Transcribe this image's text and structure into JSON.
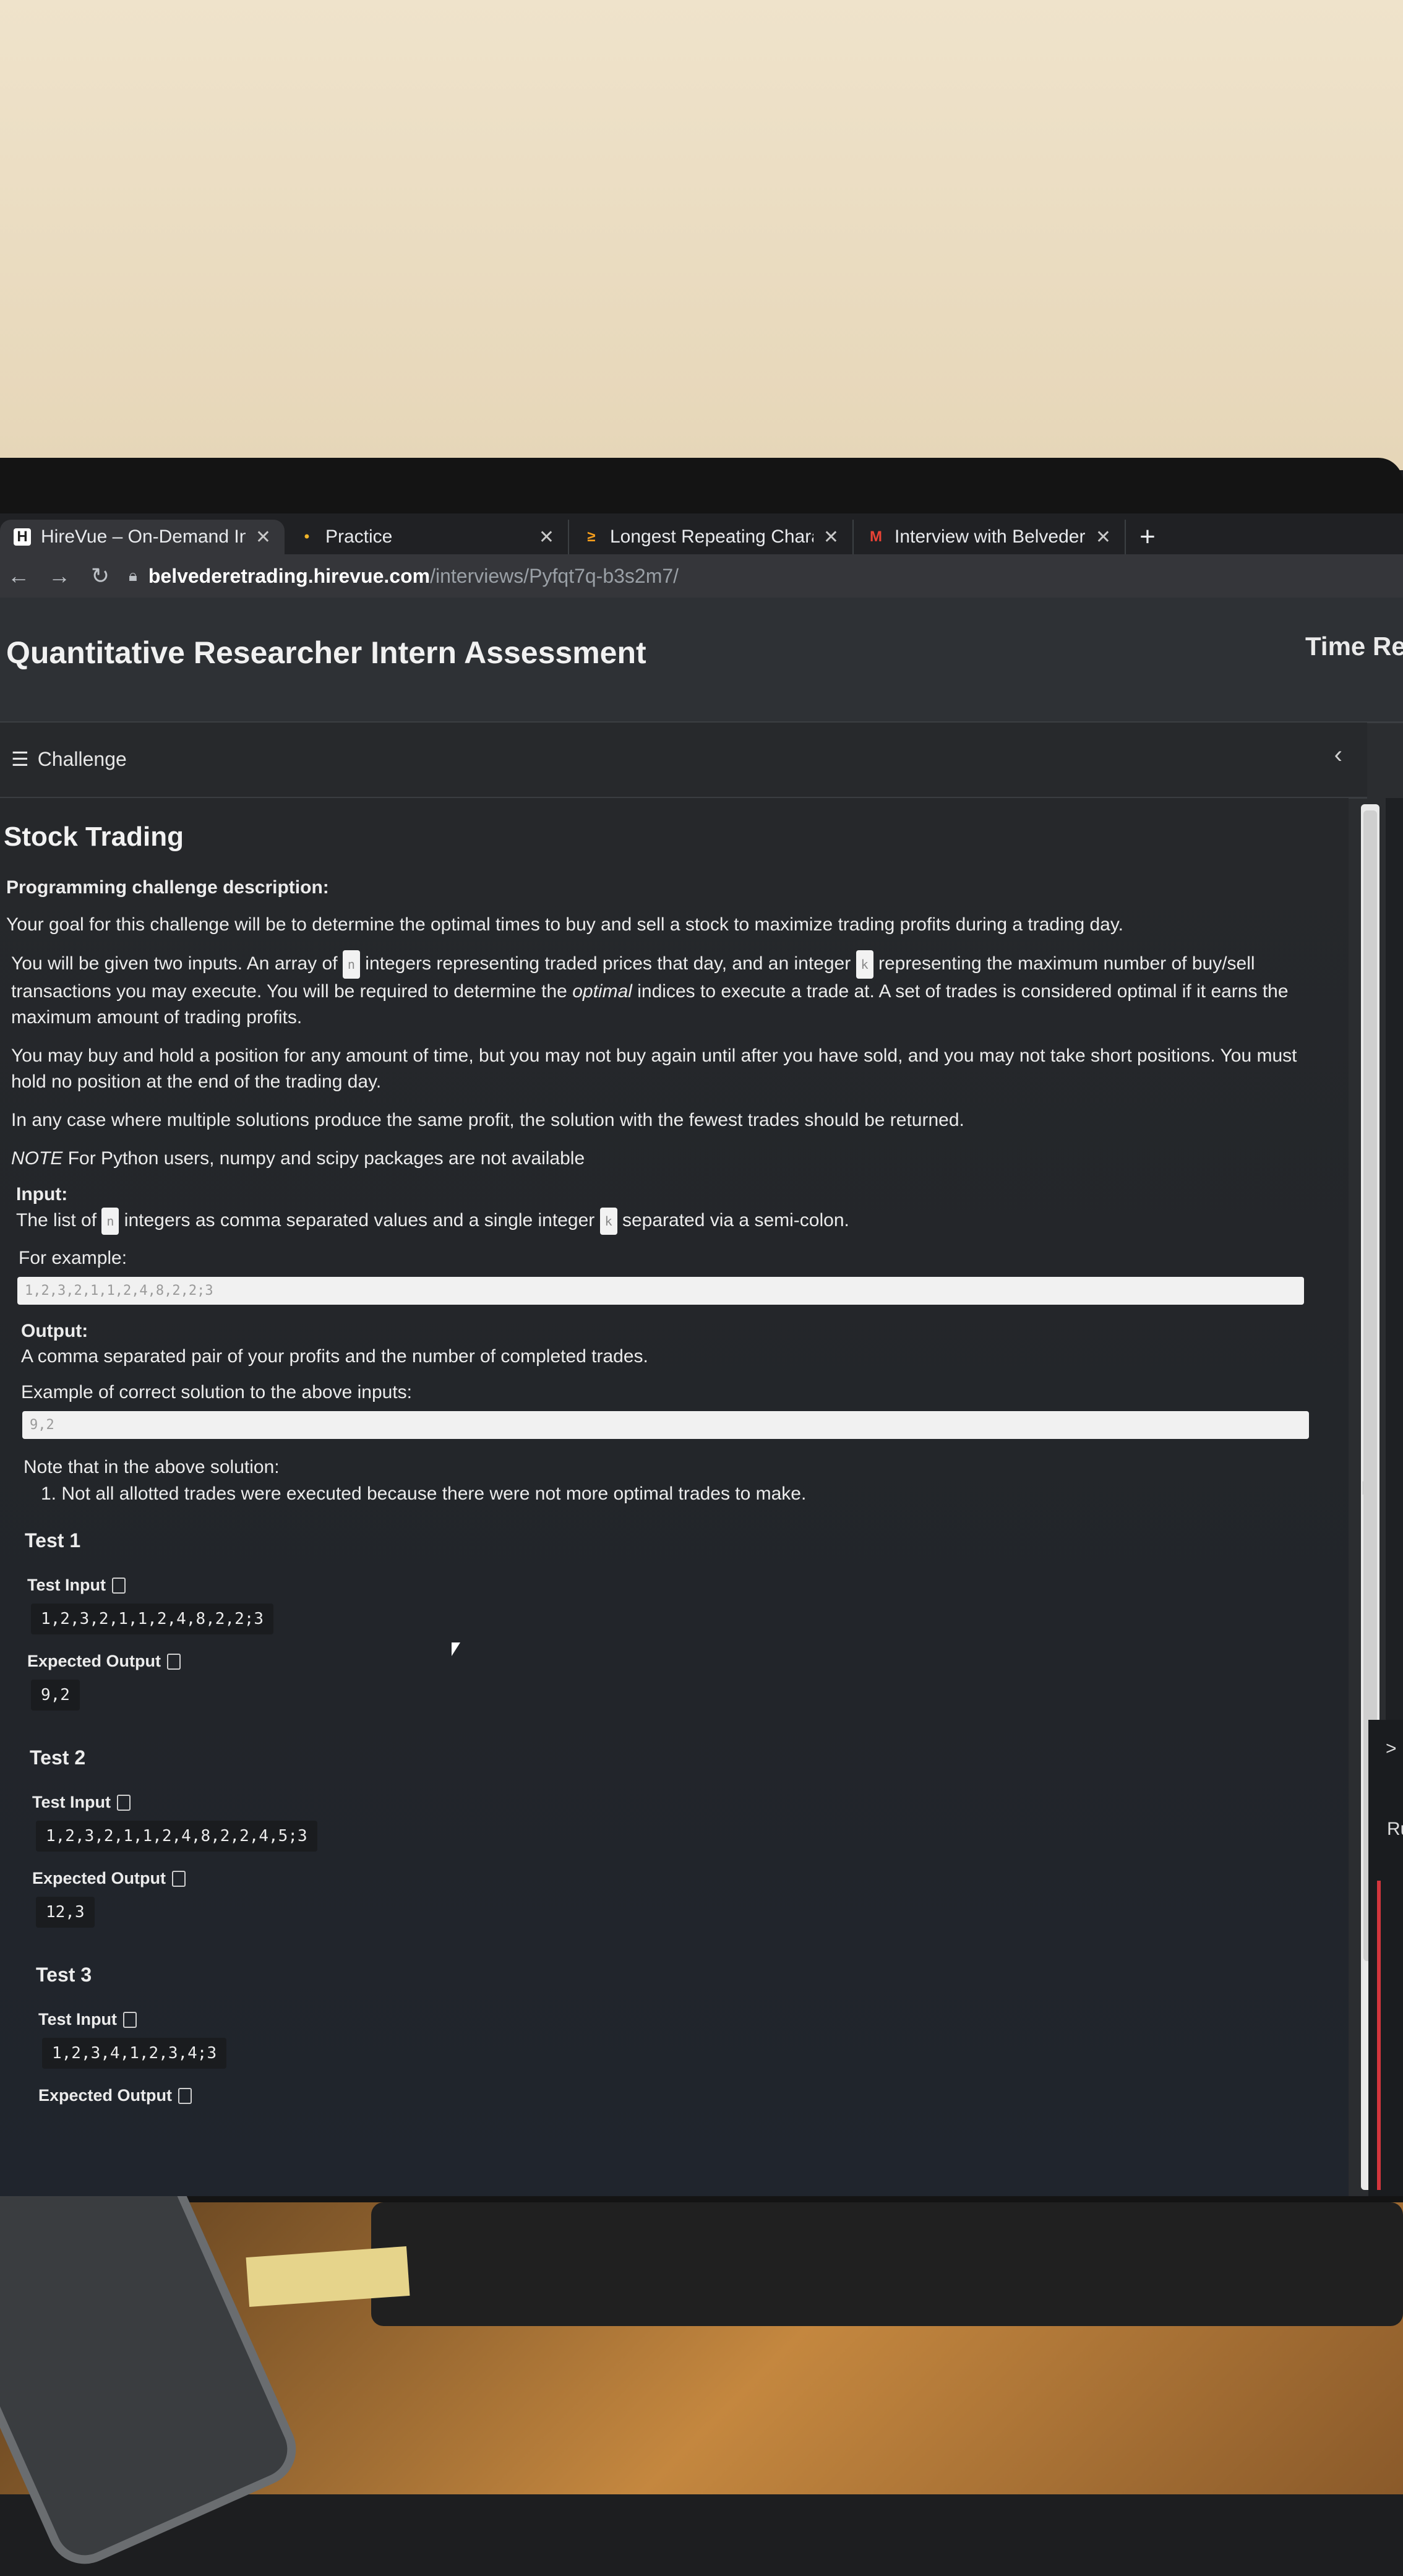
{
  "browser": {
    "tabs": [
      {
        "label": "HireVue – On-Demand Int",
        "icon": "H"
      },
      {
        "label": "Practice",
        "icon": "•"
      },
      {
        "label": "Longest Repeating Chara",
        "icon": "≥"
      },
      {
        "label": "Interview with Belvedere",
        "icon": "M"
      }
    ],
    "new_tab": "+",
    "url_host": "belvederetrading.hirevue.com",
    "url_path": "/interviews/Pyfqt7q-b3s2m7/"
  },
  "header": {
    "title": "Quantitative Researcher Intern Assessment",
    "timer_label": "Time Rer"
  },
  "challenge_bar": {
    "label": "Challenge",
    "collapse": "‹"
  },
  "problem": {
    "title": "Stock Trading",
    "desc_heading": "Programming challenge description:",
    "p1": "Your goal for this challenge will be to determine the optimal times to buy and sell a stock to maximize trading profits during a trading day.",
    "p2a": "You will be given two inputs. An array of",
    "n": "n",
    "p2b": "integers representing traded prices that day, and an integer",
    "k": "k",
    "p2c": "representing the maximum number of buy/sell transactions you may execute. You will be required to determine the",
    "p2_em": "optimal",
    "p2d": "indices to execute a trade at. A set of trades is considered optimal if it earns the maximum amount of trading profits.",
    "p3": "You may buy and hold a position for any amount of time, but you may not buy again until after you have sold, and you may not take short positions. You must hold no position at the end of the trading day.",
    "p4": "In any case where multiple solutions produce the same profit, the solution with the fewest trades should be returned.",
    "p5_em": "NOTE",
    "p5": "For Python users, numpy and scipy packages are not available",
    "input_heading": "Input:",
    "input_a": "The list of",
    "input_b": "integers as comma separated values and a single integer",
    "input_c": "separated via a semi-colon.",
    "example_label": "For example:",
    "example_input": "1,2,3,2,1,1,2,4,8,2,2;3",
    "output_heading": "Output:",
    "output_text": "A comma separated pair of your profits and the number of completed trades.",
    "example_out_label": "Example of correct solution to the above inputs:",
    "example_output": "9,2",
    "note_intro": "Note that in the above solution:",
    "note_1": "1. Not all allotted trades were executed because there were not more optimal trades to make."
  },
  "tests": [
    {
      "title": "Test 1",
      "input_label": "Test Input",
      "input": "1,2,3,2,1,1,2,4,8,2,2;3",
      "output_label": "Expected Output",
      "output": "9,2"
    },
    {
      "title": "Test 2",
      "input_label": "Test Input",
      "input": "1,2,3,2,1,1,2,4,8,2,2,4,5;3",
      "output_label": "Expected Output",
      "output": "12,3"
    },
    {
      "title": "Test 3",
      "input_label": "Test Input",
      "input": "1,2,3,4,1,2,3,4;3",
      "output_label": "Expected Output"
    }
  ],
  "right_panel": {
    "expand": ">",
    "run_label": "Ru"
  },
  "colors": {
    "accent_red": "#d2363d",
    "panel_bg": "#26282b"
  }
}
